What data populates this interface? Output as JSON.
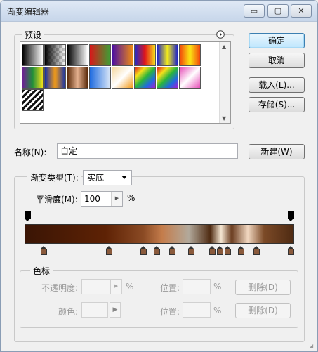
{
  "window": {
    "title": "渐变编辑器",
    "controls": {
      "minimize": "▭",
      "restore": "▢",
      "close": "✕"
    }
  },
  "presets": {
    "label": "预设",
    "menu_icon": "circle-arrow-right-icon",
    "swatches": [
      "linear-gradient(to right, #000, #fff)",
      "linear-gradient(to right, #000, transparent)",
      "linear-gradient(to right, #000, #fff)",
      "linear-gradient(to right, #d8171a, #3e9f35)",
      "linear-gradient(to right, #4b0fa2, #ee8a14)",
      "linear-gradient(to right, #1f2acb, #e2151a, #f6df1b)",
      "linear-gradient(to right, #1f24c8, #f3ec1a, #1f24c8)",
      "linear-gradient(to right, #f2450b, #fbe713, #f2450b)",
      "linear-gradient(to right, #6e1f95, #218e3a, #f0e21b)",
      "linear-gradient(to right, #1532a8, #f39c17, #1532a8)",
      "linear-gradient(to right, #5b2b0a, #e4b08e, #5b2b0a)",
      "linear-gradient(to right, #1f6bdf, #d9e6f7)",
      "linear-gradient(135deg, #f5d8a0, #fff 50%, #f39a1a)",
      "linear-gradient(135deg, #e01f1f, #f6e01a, #2ab53b, #1f6bdf, #a11fd6)",
      "linear-gradient(135deg, #e01f1f, #f6e01a, #2ab53b, #1f6bdf, #a11fd6)",
      "linear-gradient(135deg, #e64fb8, #fff, #e64fb8)",
      "repeating-linear-gradient(135deg, #111 0 3px, #fff 3px 6px)"
    ]
  },
  "buttons": {
    "ok": "确定",
    "cancel": "取消",
    "load": "载入(L)...",
    "save": "存储(S)...",
    "new": "新建(W)"
  },
  "name": {
    "label": "名称(N):",
    "value": "自定"
  },
  "gradient_type": {
    "label": "渐变类型(T):",
    "value": "实底"
  },
  "smoothness": {
    "label": "平滑度(M):",
    "value": "100",
    "unit": "%"
  },
  "gradient": {
    "css": "linear-gradient(to right, #3a1505 0%, #5e2205 30%, #8a4a24 44%, #c47c4b 51%, #b2a99b 61%, #4f2b12 69%, #f5e7d3 73%, #6a3c1f 77%, #f1d7c0 83%, #7c4a27 89%, #4e2a12 100%)",
    "color_stop_positions": [
      6,
      31,
      44,
      49,
      55,
      62,
      70,
      73,
      76,
      81,
      87,
      100
    ],
    "opacity_stop_positions": [
      0,
      100
    ]
  },
  "stops": {
    "label": "色标",
    "opacity_label": "不透明度:",
    "opacity_unit": "%",
    "position_label": "位置:",
    "position_unit": "%",
    "delete_label": "删除(D)",
    "color_label": "颜色:",
    "position2_label": "位置:",
    "position2_unit": "%",
    "delete2_label": "删除(D)"
  }
}
